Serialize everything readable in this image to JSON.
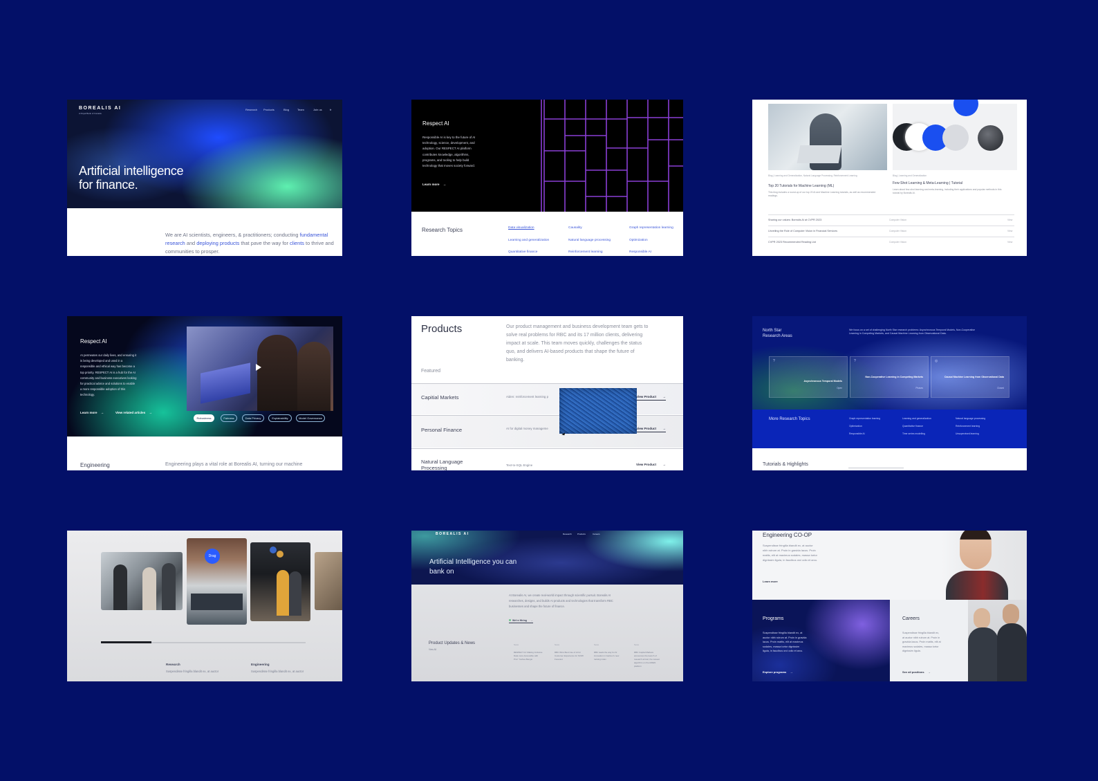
{
  "card1": {
    "logo": "BOREALIS AI",
    "logo_sub": "A Royal Bank of Canada",
    "nav": [
      "Research",
      "Products",
      "Blog",
      "Team",
      "Join us",
      "fr"
    ],
    "hero_line1": "Artificial intelligence",
    "hero_line2": "for finance.",
    "intro_a": "We are AI scientists, engineers, & practitioners; conducting",
    "intro_link1": "fundamental research",
    "intro_b": "and",
    "intro_link2": "deploying products",
    "intro_c": "that pave the way for",
    "intro_link3": "clients",
    "intro_d": "to thrive and communities to prosper."
  },
  "card2": {
    "title": "Respect AI",
    "body": [
      "Responsible AI is key to the future of AI",
      "technology, science, development, and",
      "adoption. Our RESPECT AI platform",
      "contributes knowledge, algorithms,",
      "programs, and tooling to help build",
      "technology that moves society forward."
    ],
    "learn_more": "Learn more",
    "topics_label": "Research Topics",
    "topics": [
      "Data visualization",
      "Causality",
      "Graph representation learning",
      "Learning and generalization",
      "Natural language processing",
      "Optimization",
      "Quantitative finance",
      "Reinforcement learning",
      "Responsible AI"
    ]
  },
  "card3": {
    "post1_meta": "Blog | Learning and Generalization, Natural Language Processing, Reinforcement Learning",
    "post1_title": "Top 20 Tutorials for Machine Learning (ML)",
    "post1_desc": "This blog includes a round-up of our top 20 AI and Machine Learning tutorials, as well as recommended readings.",
    "post2_meta": "Blog | Learning and Generalization",
    "post2_title": "Few-Shot Learning & Meta-Learning | Tutorial",
    "post2_desc": "Learn about few-shot learning and meta-learning, including their applications and popular methods in this tutorial by Borealis AI.",
    "list": [
      {
        "title": "Sharing our values: Borealis AI at CVPR 2023",
        "type": "Computer Vision",
        "action": "View"
      },
      {
        "title": "Unveiling the Role of Computer Vision in Financial Services",
        "type": "Computer Vision",
        "action": "View"
      },
      {
        "title": "CVPR 2023 Recommended Reading List",
        "type": "Computer Vision",
        "action": "View"
      }
    ]
  },
  "card4": {
    "title": "Respect AI",
    "body": [
      "AI permeates our daily lives, and ensuring it",
      "is being developed and used in a",
      "responsible and ethical way has become a",
      "top priority. RESPECT AI is a hub for the AI",
      "community and business executives looking",
      "for practical advice and solutions to enable",
      "a more responsible adoption of this",
      "technology."
    ],
    "learn_more": "Learn more",
    "view_articles": "View related articles",
    "pills": [
      "Robustness",
      "Fairness",
      "Data Privacy",
      "Explainability",
      "Model Governance"
    ],
    "section": "Engineering",
    "section_text": "Engineering plays a vital role at Borealis AI, turning our machine"
  },
  "card5": {
    "title": "Products",
    "intro": [
      "Our product management and business development team gets to",
      "solve real problems for RBC and its 17 million clients, delivering",
      "impact at scale. This team moves quickly, challenges the status",
      "quo, and delivers AI-based products that shape the future of",
      "banking."
    ],
    "featured": "Featured",
    "rows": [
      {
        "name": "Capitial Markets",
        "desc": "Aiden: reinforcement learning p",
        "action": "View Product"
      },
      {
        "name": "Personal Finance",
        "desc": "AI for digital money manageme",
        "action": "View Product"
      },
      {
        "name": "Natural Language Processing",
        "desc": "Text-to-SQL Engine",
        "action": "View Product"
      }
    ]
  },
  "card6": {
    "title_line1": "North Star",
    "title_line2": "Research Areas",
    "intro": [
      "We focus on a set of challenging North Star research problems: Asynchronous Temporal Models, Non-Cooperative",
      "Learning in Competing Markets, and Causal Machine Learning from Observational Data."
    ],
    "tiles": [
      {
        "title": "Asynchronous Temporal Models",
        "tag": "Open"
      },
      {
        "title": "Non-Cooperative Learning in Competing Markets",
        "tag": "Phases"
      },
      {
        "title": "Causal Machine Learning from Observational Data",
        "tag": "Closed"
      }
    ],
    "more_label": "More Research Topics",
    "more_topics": [
      "Graph representation learning",
      "Learning and generalization",
      "Natural language processing",
      "Optimization",
      "Quantitative finance",
      "Reinforcement learning",
      "Responsible AI",
      "Time series modelling",
      "Unsupervised learning"
    ],
    "footer": "Tutorials & Highlights"
  },
  "card7": {
    "tag": "Drag",
    "col1_title": "Research",
    "col1_text": "Suspendisse fringilla blandit ex, at auctor",
    "col2_title": "Engineering",
    "col2_text": "Suspendisse fringilla blandit ex, at auctor"
  },
  "card8": {
    "logo": "BOREALIS AI",
    "nav": [
      "Research",
      "Products",
      "Careers"
    ],
    "hero_line1": "Artificial Intelligence you can",
    "hero_line2": "bank on",
    "intro": [
      "At Borealis AI, we create real-world impact through scientific pursuit. Borealis AI",
      "researches, designs, and builds AI products and technologies that transform RBC",
      "businesses and shape the future of finance."
    ],
    "hiring": "We're Hiring",
    "updates_title": "Product Updates & News",
    "updates_sub": "View All",
    "news": [
      {
        "label": "News",
        "text": "RESPECT AI: Making Inclusive Data more Accessible with Prof. Yoshua Bengio"
      },
      {
        "label": "News",
        "text": "RBC Wins Best Use of AI for Customer Experience for NOMI Forecast"
      },
      {
        "label": "News",
        "text": "RBC leads the way for AI innovation in Gartner's new ranking index"
      },
      {
        "label": "News",
        "text": "RBC Capital Markets announces the launch of research arrival, the newest algorithm on the AIDEN platform"
      }
    ]
  },
  "card9": {
    "title": "Engineering CO-OP",
    "text": [
      "Suspendisse fringilla blandit ex, at auctor",
      "nibh rutrum at. Proin in gravida lacus. Proin",
      "mattis, elit at maximus sodales, massa tortor",
      "dignissim ligula, in faucibus orci odio et arcu."
    ],
    "learn_more": "Learn more",
    "programs_title": "Programs",
    "programs_text": [
      "Suspendisse fringilla blandit ex, at",
      "auctor nibh rutrum at. Proin in gravida",
      "lacus. Proin mattis, elit at maximus",
      "sodales, massa tortor dignissim",
      "ligula, in faucibus orci odio et arcu."
    ],
    "programs_link": "Explore programs",
    "careers_title": "Careers",
    "careers_text": [
      "Suspendisse fringilla blandit ex,",
      "at auctor nibh rutrum at. Proin in",
      "gravida lacus. Proin mattis, elit at",
      "maximus sodales, massa tortor",
      "dignissim ligula."
    ],
    "careers_link": "See all positions"
  },
  "arrow": "→"
}
